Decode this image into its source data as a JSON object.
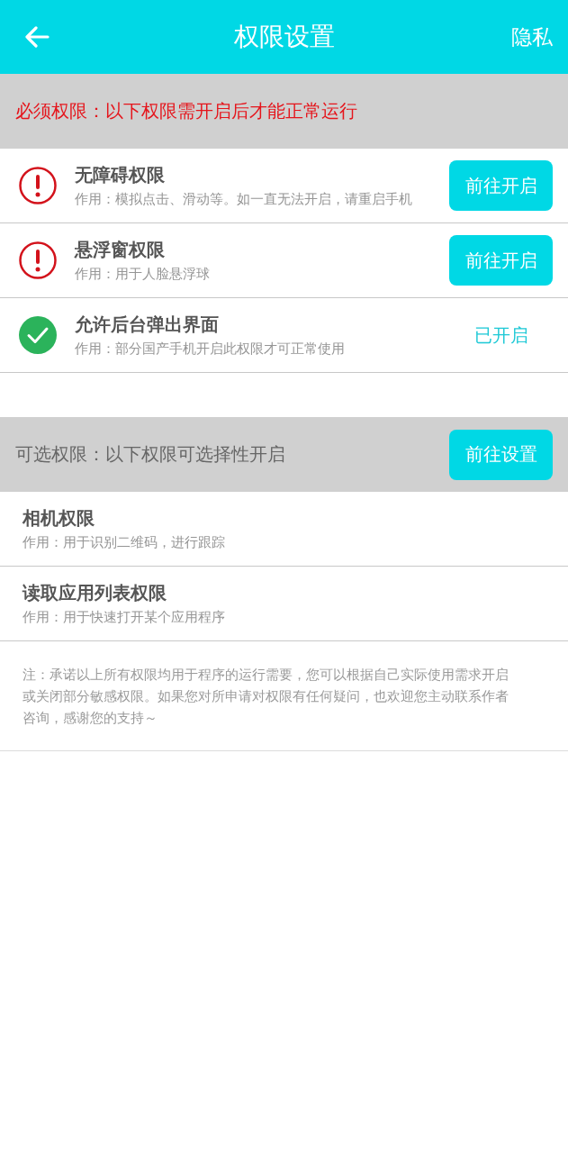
{
  "header": {
    "title": "权限设置",
    "right_action": "隐私"
  },
  "required": {
    "heading": "必须权限：以下权限需开启后才能正常运行",
    "items": [
      {
        "title": "无障碍权限",
        "description": "作用：模拟点击、滑动等。如一直无法开启，请重启手机",
        "enabled": false,
        "action": "前往开启"
      },
      {
        "title": "悬浮窗权限",
        "description": "作用：用于人脸悬浮球",
        "enabled": false,
        "action": "前往开启"
      },
      {
        "title": "允许后台弹出界面",
        "description": "作用：部分国产手机开启此权限才可正常使用",
        "enabled": true,
        "action": "已开启"
      }
    ]
  },
  "optional": {
    "heading": "可选权限：以下权限可选择性开启",
    "button": "前往设置",
    "items": [
      {
        "title": "相机权限",
        "description": "作用：用于识别二维码，进行跟踪"
      },
      {
        "title": "读取应用列表权限",
        "description": "作用：用于快速打开某个应用程序"
      }
    ]
  },
  "note": "注：承诺以上所有权限均用于程序的运行需要，您可以根据自己实际使用需求开启或关闭部分敏感权限。如果您对所申请对权限有任何疑问，也欢迎您主动联系作者咨询，感谢您的支持～"
}
